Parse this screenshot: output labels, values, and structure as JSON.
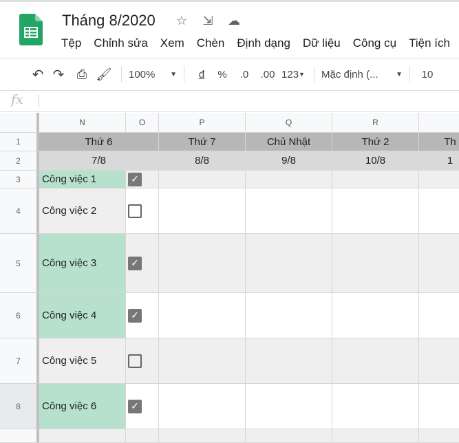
{
  "doc": {
    "title": "Tháng 8/2020"
  },
  "menu": [
    "Tệp",
    "Chỉnh sửa",
    "Xem",
    "Chèn",
    "Định dạng",
    "Dữ liệu",
    "Công cụ",
    "Tiện ích"
  ],
  "toolbar": {
    "zoom": "100%",
    "currency": "đ",
    "percent": "%",
    "dec_less": ".0",
    "dec_more": ".00",
    "format": "123",
    "font": "Mặc định (...",
    "font_size": "10"
  },
  "formula": {
    "label": "fx",
    "value": ""
  },
  "columns": [
    "N",
    "O",
    "P",
    "Q",
    "R"
  ],
  "rows": [
    "1",
    "2",
    "3",
    "4",
    "5",
    "6",
    "7",
    "8"
  ],
  "days": [
    {
      "day": "Thứ 6",
      "date": "7/8"
    },
    {
      "day": "Thứ 7",
      "date": "8/8"
    },
    {
      "day": "Chủ Nhật",
      "date": "9/8"
    },
    {
      "day": "Thứ 2",
      "date": "10/8"
    },
    {
      "day": "Th",
      "date": "1"
    }
  ],
  "tasks": [
    {
      "label": "Công việc 1",
      "done": true
    },
    {
      "label": "Công việc 2",
      "done": false
    },
    {
      "label": "Công việc 3",
      "done": true
    },
    {
      "label": "Công việc 4",
      "done": true
    },
    {
      "label": "Công việc 5",
      "done": false
    },
    {
      "label": "Công việc 6",
      "done": true
    }
  ],
  "colors": {
    "green": "#b7e1cd",
    "header_dark": "#b7b7b7",
    "header_light": "#d9d9d9",
    "band": "#efefef"
  }
}
